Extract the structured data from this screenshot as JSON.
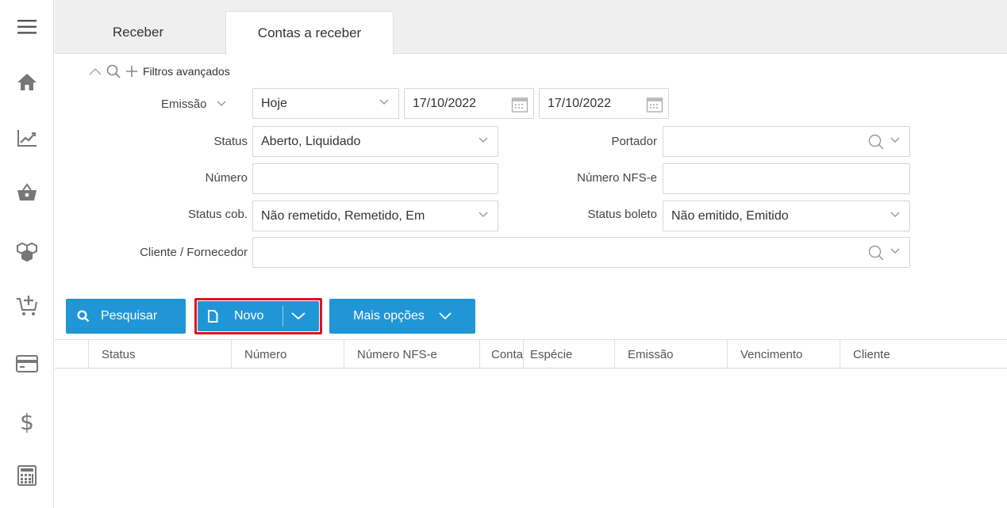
{
  "sidebar": {
    "items": [
      {
        "icon": "hamburger-menu-icon"
      },
      {
        "icon": "home-icon"
      },
      {
        "icon": "chart-line-icon"
      },
      {
        "icon": "basket-icon"
      },
      {
        "icon": "boxes-icon"
      },
      {
        "icon": "cart-add-icon"
      },
      {
        "icon": "credit-card-icon"
      },
      {
        "icon": "dollar-icon"
      },
      {
        "icon": "calculator-icon"
      }
    ]
  },
  "tabs": [
    {
      "label": "Receber"
    },
    {
      "label": "Contas a receber"
    }
  ],
  "filters": {
    "advanced_label": "Filtros avançados",
    "emissao_label": "Emissão",
    "emissao_period": "Hoje",
    "date_from": "17/10/2022",
    "date_to": "17/10/2022",
    "status_label": "Status",
    "status_value": "Aberto, Liquidado",
    "portador_label": "Portador",
    "portador_value": "",
    "numero_label": "Número",
    "numero_value": "",
    "numero_nfse_label": "Número NFS-e",
    "numero_nfse_value": "",
    "status_cob_label": "Status cob.",
    "status_cob_value": "Não remetido, Remetido, Em",
    "status_boleto_label": "Status boleto",
    "status_boleto_value": "Não emitido, Emitido",
    "cliente_label": "Cliente / Fornecedor",
    "cliente_value": ""
  },
  "toolbar": {
    "search_label": "Pesquisar",
    "new_label": "Novo",
    "more_label": "Mais opções"
  },
  "table": {
    "columns": [
      "Status",
      "Número",
      "Número NFS-e",
      "Conta",
      "Espécie",
      "Emissão",
      "Vencimento",
      "Cliente"
    ]
  },
  "colors": {
    "accent": "#2196d7",
    "highlight": "#e01421"
  }
}
